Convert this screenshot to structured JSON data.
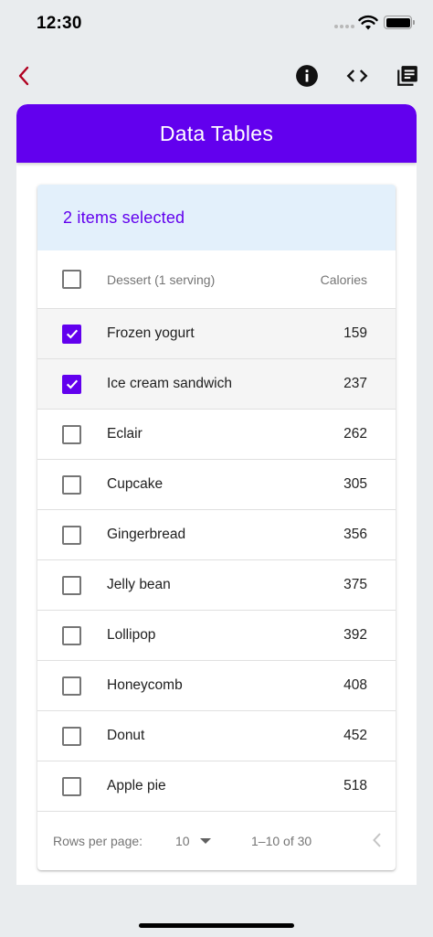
{
  "status_bar": {
    "time": "12:30"
  },
  "app_bar": {
    "title": "Data Tables"
  },
  "table": {
    "selection_text": "2 items selected",
    "columns": {
      "dessert": "Dessert (1 serving)",
      "calories": "Calories"
    },
    "rows": [
      {
        "name": "Frozen yogurt",
        "calories": "159",
        "selected": true
      },
      {
        "name": "Ice cream sandwich",
        "calories": "237",
        "selected": true
      },
      {
        "name": "Eclair",
        "calories": "262",
        "selected": false
      },
      {
        "name": "Cupcake",
        "calories": "305",
        "selected": false
      },
      {
        "name": "Gingerbread",
        "calories": "356",
        "selected": false
      },
      {
        "name": "Jelly bean",
        "calories": "375",
        "selected": false
      },
      {
        "name": "Lollipop",
        "calories": "392",
        "selected": false
      },
      {
        "name": "Honeycomb",
        "calories": "408",
        "selected": false
      },
      {
        "name": "Donut",
        "calories": "452",
        "selected": false
      },
      {
        "name": "Apple pie",
        "calories": "518",
        "selected": false
      }
    ],
    "footer": {
      "rows_per_page_label": "Rows per page:",
      "rows_per_page_value": "10",
      "range": "1–10 of 30"
    }
  },
  "icons": {
    "back": "chevron-left-icon",
    "info": "info-icon",
    "code": "code-icon",
    "library": "library-books-icon",
    "dropdown": "arrow-drop-down-icon",
    "prev": "chevron-left-icon"
  },
  "colors": {
    "primary": "#6200ee",
    "back_accent": "#b00020",
    "selection_banner": "#e3f0fb",
    "background": "#e9ecee"
  }
}
